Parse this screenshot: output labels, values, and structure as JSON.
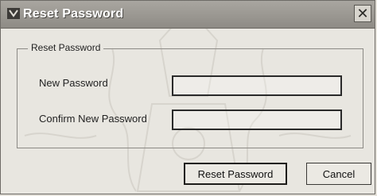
{
  "window": {
    "title": "Reset Password",
    "close_glyph": "✕"
  },
  "group": {
    "label": "Reset Password"
  },
  "fields": {
    "new_password": {
      "label": "New Password",
      "value": ""
    },
    "confirm_password": {
      "label": "Confirm New Password",
      "value": ""
    }
  },
  "buttons": {
    "reset_label": "Reset Password",
    "cancel_label": "Cancel"
  },
  "icons": {
    "title": "app-icon",
    "close": "close-icon"
  }
}
